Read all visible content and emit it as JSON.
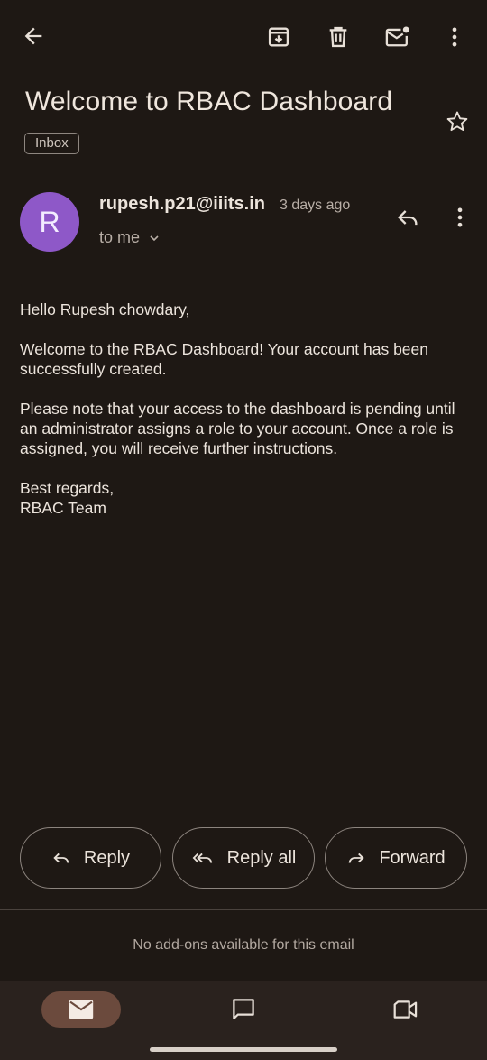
{
  "email": {
    "subject": "Welcome to RBAC Dashboard",
    "label": "Inbox",
    "sender": "rupesh.p21@iiits.in",
    "avatar_letter": "R",
    "time": "3 days ago",
    "recipient_line": "to me",
    "body": [
      "Hello Rupesh chowdary,",
      "Welcome to the RBAC Dashboard! Your account has been successfully created.",
      "Please note that your access to the dashboard is pending until an administrator assigns a role to your account. Once a role is assigned, you will receive further instructions.",
      "Best regards,",
      "RBAC Team"
    ]
  },
  "actions": {
    "reply": "Reply",
    "reply_all": "Reply all",
    "forward": "Forward"
  },
  "addons_note": "No add-ons available for this email",
  "toolbar": {
    "icons": [
      "back-arrow-icon",
      "archive-icon",
      "delete-icon",
      "mark-unread-icon",
      "more-vert-icon"
    ]
  },
  "bottom_nav": {
    "items": [
      "mail-icon",
      "chat-icon",
      "meet-icon"
    ],
    "active_color": "#6b4a3d"
  },
  "colors": {
    "background": "#1e1814",
    "avatar": "#8e58c8",
    "nav_background": "#2a221e"
  }
}
